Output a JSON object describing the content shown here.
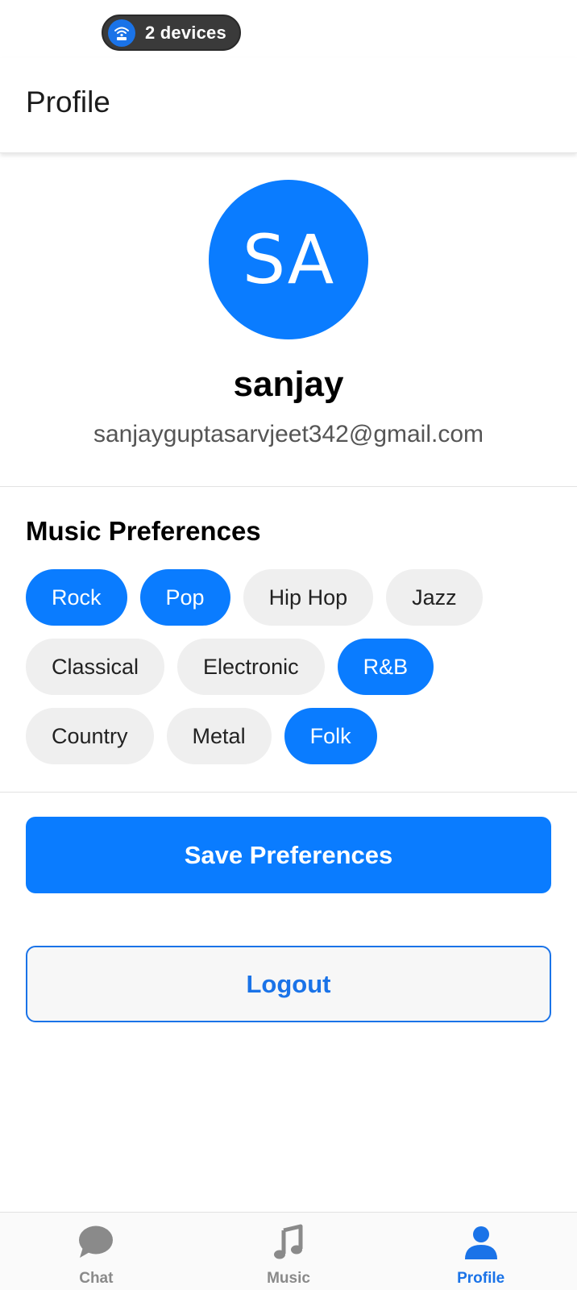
{
  "status": {
    "devices_label": "2 devices",
    "icon": "wifi-devices-icon"
  },
  "header": {
    "title": "Profile"
  },
  "profile": {
    "initials": "SA",
    "name": "sanjay",
    "email": "sanjayguptasarvjeet342@gmail.com"
  },
  "preferences": {
    "title": "Music Preferences",
    "genres": [
      {
        "label": "Rock",
        "selected": true
      },
      {
        "label": "Pop",
        "selected": true
      },
      {
        "label": "Hip Hop",
        "selected": false
      },
      {
        "label": "Jazz",
        "selected": false
      },
      {
        "label": "Classical",
        "selected": false
      },
      {
        "label": "Electronic",
        "selected": false
      },
      {
        "label": "R&B",
        "selected": true
      },
      {
        "label": "Country",
        "selected": false
      },
      {
        "label": "Metal",
        "selected": false
      },
      {
        "label": "Folk",
        "selected": true
      }
    ]
  },
  "actions": {
    "save_label": "Save Preferences",
    "logout_label": "Logout"
  },
  "nav": {
    "items": [
      {
        "label": "Chat",
        "icon": "chat-icon",
        "active": false
      },
      {
        "label": "Music",
        "icon": "music-note-icon",
        "active": false
      },
      {
        "label": "Profile",
        "icon": "person-icon",
        "active": true
      }
    ]
  },
  "colors": {
    "accent": "#0a7cff",
    "chip_bg": "#efefef",
    "nav_inactive": "#8a8a8a"
  }
}
